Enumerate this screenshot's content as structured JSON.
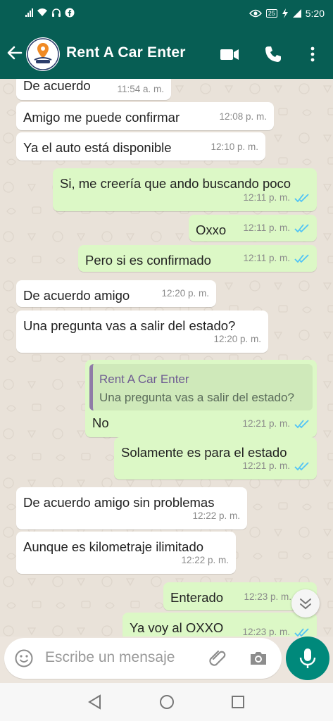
{
  "status": {
    "battery": "25",
    "time": "5:20"
  },
  "header": {
    "contact_name": "Rent A Car Enter"
  },
  "messages": [
    {
      "dir": "in",
      "text": "De acuerdo",
      "time": "11:54 a. m."
    },
    {
      "dir": "in",
      "text": "Amigo me puede confirmar",
      "time": "12:08 p. m."
    },
    {
      "dir": "in",
      "text": "Ya el auto está disponible",
      "time": "12:10 p. m."
    },
    {
      "dir": "out",
      "text": "Si, me creería que ando buscando poco",
      "time": "12:11 p. m."
    },
    {
      "dir": "out",
      "text": "Oxxo",
      "time": "12:11 p. m."
    },
    {
      "dir": "out",
      "text": "Pero si es confirmado",
      "time": "12:11 p. m."
    },
    {
      "dir": "in",
      "text": "De acuerdo amigo",
      "time": "12:20 p. m."
    },
    {
      "dir": "in",
      "text": "Una pregunta vas a salir del estado?",
      "time": "12:20 p. m."
    },
    {
      "dir": "out",
      "text": "No",
      "time": "12:21 p. m.",
      "quote": {
        "name": "Rent A Car Enter",
        "text": "Una pregunta vas a salir del estado?"
      }
    },
    {
      "dir": "out",
      "text": "Solamente es para el estado",
      "time": "12:21 p. m."
    },
    {
      "dir": "in",
      "text": "De acuerdo amigo sin problemas",
      "time": "12:22 p. m."
    },
    {
      "dir": "in",
      "text": "Aunque es kilometraje ilimitado",
      "time": "12:22 p. m."
    },
    {
      "dir": "out",
      "text": "Enterado",
      "time": "12:23 p. m."
    },
    {
      "dir": "out",
      "text": "Ya voy al OXXO",
      "time": "12:23 p. m."
    }
  ],
  "composer": {
    "placeholder": "Escribe un mensaje"
  },
  "icons": {
    "back": "arrow-left-icon",
    "video": "video-call-icon",
    "call": "phone-icon",
    "menu": "more-vert-icon",
    "emoji": "emoji-icon",
    "attach": "paperclip-icon",
    "camera": "camera-icon",
    "mic": "mic-icon",
    "scroll": "chevron-double-down-icon"
  },
  "colors": {
    "primary": "#075e54",
    "outgoing": "#dcf8c6",
    "incoming": "#ffffff",
    "accent": "#00897b",
    "read_ticks": "#4fc3f7"
  }
}
